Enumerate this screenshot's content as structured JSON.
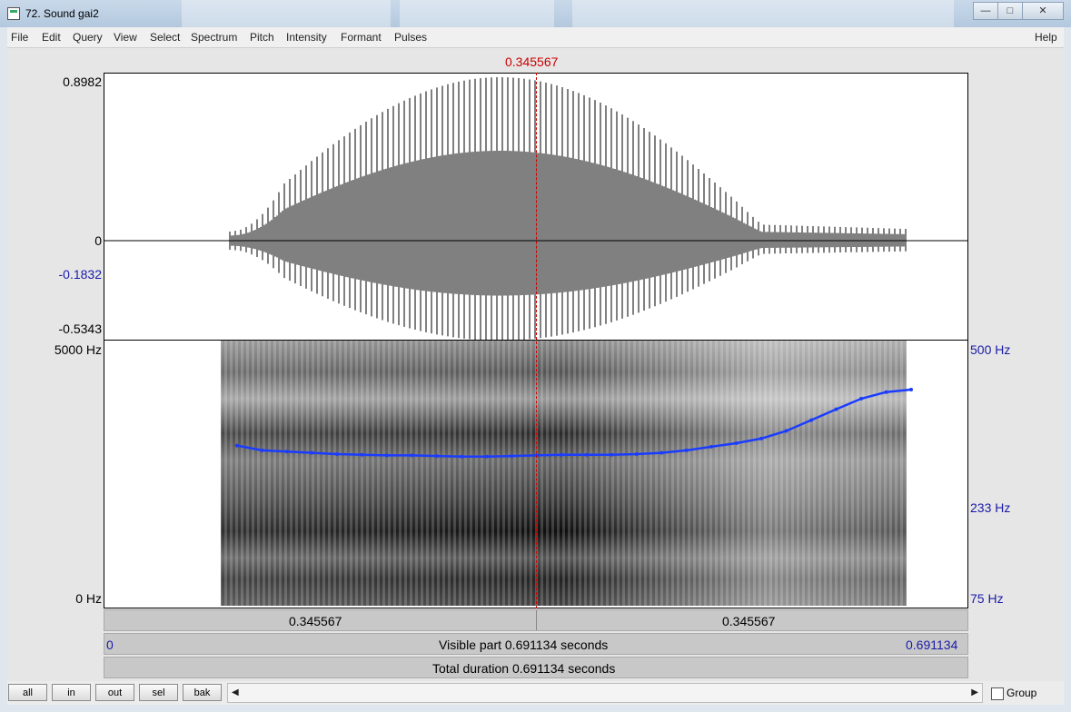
{
  "window": {
    "title": "72. Sound gai2",
    "min": "—",
    "max": "□",
    "close": "✕"
  },
  "menu": [
    "File",
    "Edit",
    "Query",
    "View",
    "Select",
    "Spectrum",
    "Pitch",
    "Intensity",
    "Formant",
    "Pulses",
    "Help"
  ],
  "cursor_time": "0.345567",
  "waveform": {
    "max": "0.8982",
    "zero": "0",
    "cursor_value": "-0.1832",
    "min": "-0.5343"
  },
  "spectrogram": {
    "freq_top": "5000 Hz",
    "freq_bottom": "0 Hz"
  },
  "pitch": {
    "top": "500 Hz",
    "cursor": "233 Hz",
    "bottom": "75 Hz",
    "contour_hz": [
      236,
      228,
      226,
      224,
      222,
      221,
      220,
      220,
      219,
      218,
      218,
      219,
      220,
      221,
      221,
      221,
      222,
      224,
      228,
      234,
      240,
      248,
      262,
      283,
      306,
      330,
      346,
      352
    ]
  },
  "time_bar": {
    "left": "0.345567",
    "right": "0.345567"
  },
  "visible_bar": {
    "start": "0",
    "label": "Visible part 0.691134 seconds",
    "end": "0.691134"
  },
  "total_bar": {
    "label": "Total duration 0.691134 seconds"
  },
  "buttons": {
    "all": "all",
    "in": "in",
    "out": "out",
    "sel": "sel",
    "bak": "bak"
  },
  "group_label": "Group",
  "colors": {
    "cursor": "#cc0000",
    "pitch_curve": "#1a3cff",
    "axis_blue": "#1a1aa8"
  }
}
